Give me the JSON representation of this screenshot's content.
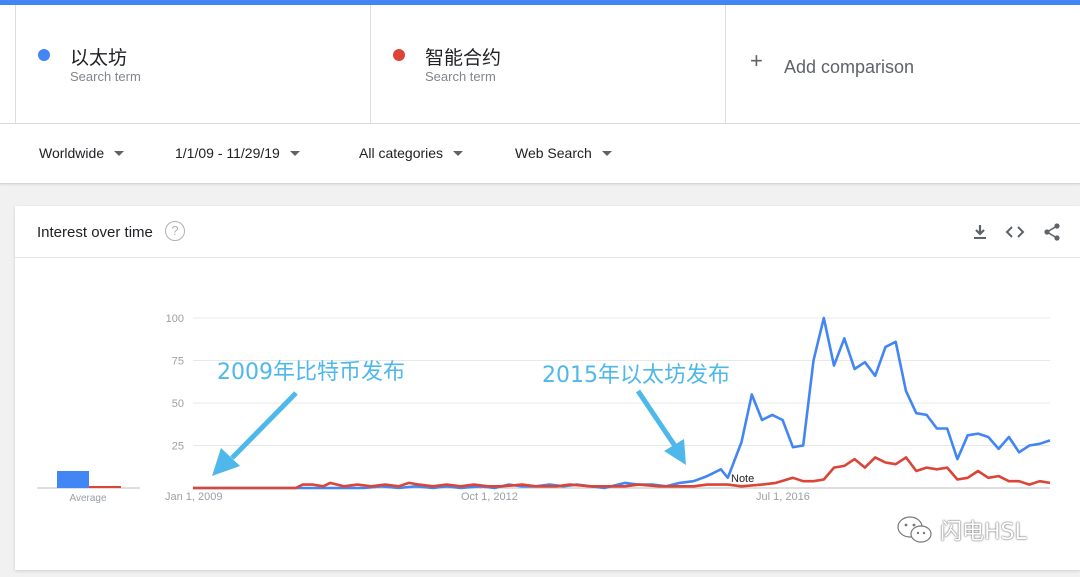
{
  "terms": [
    {
      "name": "以太坊",
      "sub": "Search term",
      "color": "#4285f4"
    },
    {
      "name": "智能合约",
      "sub": "Search term",
      "color": "#db4437"
    }
  ],
  "add_comparison": {
    "label": "Add comparison"
  },
  "filters": {
    "region": "Worldwide",
    "date_range": "1/1/09 - 11/29/19",
    "category": "All categories",
    "search_type": "Web Search"
  },
  "card": {
    "title": "Interest over time"
  },
  "annotations": {
    "bitcoin": "2009年比特币发布",
    "ethereum": "2015年以太坊发布"
  },
  "watermark": "闪电HSL",
  "chart_data": {
    "type": "line",
    "title": "Interest over time",
    "ylim": [
      0,
      100
    ],
    "yticks": [
      "100",
      "75",
      "50",
      "25"
    ],
    "xticks": [
      "Jan 1, 2009",
      "Oct 1, 2012",
      "Jul 1, 2016"
    ],
    "note_label": "Note",
    "average_label": "Average",
    "average": {
      "以太坊": 10,
      "智能合约": 1
    },
    "series": [
      {
        "name": "以太坊",
        "color": "#4285f4",
        "points": [
          [
            0,
            0
          ],
          [
            30,
            0
          ],
          [
            40,
            0
          ],
          [
            50,
            0
          ],
          [
            55,
            1
          ],
          [
            60,
            0
          ],
          [
            65,
            1
          ],
          [
            70,
            0
          ],
          [
            74,
            1
          ],
          [
            78,
            0
          ],
          [
            84,
            1
          ],
          [
            88,
            0
          ],
          [
            92,
            2
          ],
          [
            96,
            1
          ],
          [
            100,
            1
          ],
          [
            104,
            2
          ],
          [
            108,
            1
          ],
          [
            112,
            2
          ],
          [
            116,
            1
          ],
          [
            120,
            0
          ],
          [
            126,
            3
          ],
          [
            130,
            2
          ],
          [
            134,
            2
          ],
          [
            138,
            1
          ],
          [
            142,
            3
          ],
          [
            146,
            4
          ],
          [
            150,
            7
          ],
          [
            154,
            11
          ],
          [
            156,
            6
          ],
          [
            160,
            27
          ],
          [
            163,
            55
          ],
          [
            166,
            40
          ],
          [
            169,
            43
          ],
          [
            172,
            40
          ],
          [
            175,
            24
          ],
          [
            178,
            25
          ],
          [
            181,
            75
          ],
          [
            184,
            100
          ],
          [
            187,
            72
          ],
          [
            190,
            88
          ],
          [
            193,
            70
          ],
          [
            196,
            74
          ],
          [
            199,
            66
          ],
          [
            202,
            83
          ],
          [
            205,
            86
          ],
          [
            208,
            57
          ],
          [
            211,
            44
          ],
          [
            214,
            43
          ],
          [
            217,
            35
          ],
          [
            220,
            35
          ],
          [
            223,
            17
          ],
          [
            226,
            31
          ],
          [
            229,
            32
          ],
          [
            232,
            30
          ],
          [
            235,
            23
          ],
          [
            238,
            30
          ],
          [
            241,
            21
          ],
          [
            244,
            25
          ],
          [
            247,
            26
          ],
          [
            250,
            28
          ]
        ]
      },
      {
        "name": "智能合约",
        "color": "#db4437",
        "points": [
          [
            0,
            0
          ],
          [
            30,
            0
          ],
          [
            32,
            2
          ],
          [
            35,
            2
          ],
          [
            38,
            1
          ],
          [
            40,
            3
          ],
          [
            44,
            1
          ],
          [
            48,
            2
          ],
          [
            52,
            1
          ],
          [
            56,
            2
          ],
          [
            60,
            1
          ],
          [
            63,
            3
          ],
          [
            66,
            2
          ],
          [
            70,
            1
          ],
          [
            74,
            2
          ],
          [
            78,
            1
          ],
          [
            82,
            2
          ],
          [
            86,
            1
          ],
          [
            90,
            1
          ],
          [
            96,
            2
          ],
          [
            100,
            1
          ],
          [
            106,
            1
          ],
          [
            110,
            2
          ],
          [
            116,
            1
          ],
          [
            120,
            1
          ],
          [
            126,
            1
          ],
          [
            130,
            2
          ],
          [
            136,
            1
          ],
          [
            140,
            1
          ],
          [
            146,
            1
          ],
          [
            150,
            2
          ],
          [
            156,
            2
          ],
          [
            160,
            1
          ],
          [
            166,
            2
          ],
          [
            170,
            3
          ],
          [
            175,
            6
          ],
          [
            178,
            4
          ],
          [
            181,
            4
          ],
          [
            184,
            5
          ],
          [
            187,
            12
          ],
          [
            190,
            13
          ],
          [
            193,
            17
          ],
          [
            196,
            12
          ],
          [
            199,
            18
          ],
          [
            202,
            15
          ],
          [
            205,
            14
          ],
          [
            208,
            18
          ],
          [
            211,
            10
          ],
          [
            214,
            12
          ],
          [
            217,
            11
          ],
          [
            220,
            12
          ],
          [
            223,
            5
          ],
          [
            226,
            6
          ],
          [
            229,
            10
          ],
          [
            232,
            6
          ],
          [
            235,
            7
          ],
          [
            238,
            4
          ],
          [
            241,
            4
          ],
          [
            244,
            2
          ],
          [
            247,
            4
          ],
          [
            250,
            3
          ]
        ]
      }
    ],
    "x_domain": [
      0,
      250
    ]
  }
}
